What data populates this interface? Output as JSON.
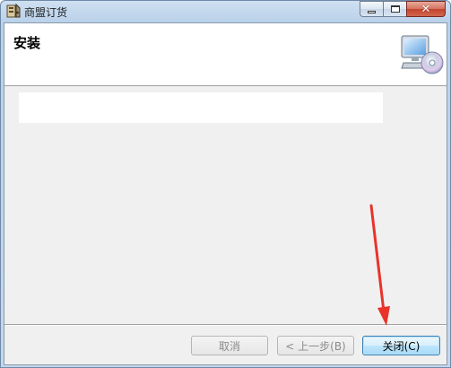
{
  "window": {
    "title": "商盟订货",
    "icons": {
      "app": "installer-icon",
      "minimize": "minimize-icon",
      "maximize": "maximize-icon",
      "close": "close-icon"
    }
  },
  "banner": {
    "title": "安装",
    "art_icon": "computer-cd-icon"
  },
  "progress": {
    "value": 0
  },
  "buttons": {
    "cancel": "取消",
    "back": "< 上一步(B)",
    "close": "关闭(C)"
  },
  "colors": {
    "annotation_arrow": "#e8332a",
    "close_button_border": "#3c7fb1",
    "disabled_text": "#8c8c8c"
  }
}
